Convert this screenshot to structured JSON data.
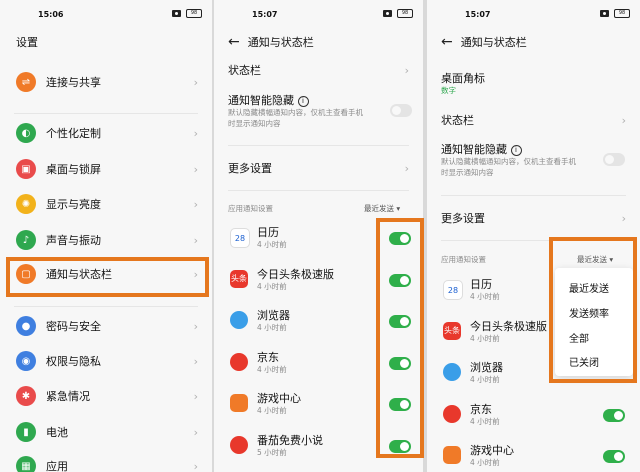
{
  "panel1": {
    "time": "15:06",
    "battery": "98",
    "title": "设置",
    "items": [
      {
        "label": "连接与共享",
        "icon": "share-icon",
        "color": "#f07a28"
      },
      {
        "label": "个性化定制",
        "icon": "palette-icon",
        "color": "#2fa84f"
      },
      {
        "label": "桌面与锁屏",
        "icon": "image-icon",
        "color": "#e94b4b"
      },
      {
        "label": "显示与亮度",
        "icon": "sun-icon",
        "color": "#f2b21b"
      },
      {
        "label": "声音与振动",
        "icon": "bell-icon",
        "color": "#2fa84f"
      },
      {
        "label": "通知与状态栏",
        "icon": "notification-icon",
        "color": "#f07a28"
      },
      {
        "label": "密码与安全",
        "icon": "lock-icon",
        "color": "#3f7fe0"
      },
      {
        "label": "权限与隐私",
        "icon": "eye-icon",
        "color": "#3f7fe0"
      },
      {
        "label": "紧急情况",
        "icon": "alert-icon",
        "color": "#e94b4b"
      },
      {
        "label": "电池",
        "icon": "battery-icon",
        "color": "#2fa84f"
      },
      {
        "label": "应用",
        "icon": "apps-icon",
        "color": "#2fa84f"
      }
    ]
  },
  "panel2": {
    "time": "15:07",
    "battery": "98",
    "title": "通知与状态栏",
    "status_bar": "状态栏",
    "smart_hide": "通知智能隐藏",
    "smart_hide_desc": "默认隐藏横幅通知内容，仅机主查看手机时显示通知内容",
    "more_settings": "更多设置",
    "app_notif_header": "应用通知设置",
    "sort_label": "最近发送",
    "apps": [
      {
        "name": "日历",
        "time": "4 小时前",
        "badge": "28",
        "color": "#ffffff"
      },
      {
        "name": "今日头条极速版",
        "time": "4 小时前",
        "badge": "头条",
        "color": "#e8382c"
      },
      {
        "name": "浏览器",
        "time": "4 小时前",
        "badge": "",
        "color": "#3a9ee8"
      },
      {
        "name": "京东",
        "time": "4 小时前",
        "badge": "",
        "color": "#e8382c"
      },
      {
        "name": "游戏中心",
        "time": "4 小时前",
        "badge": "",
        "color": "#f07a28"
      },
      {
        "name": "番茄免费小说",
        "time": "5 小时前",
        "badge": "",
        "color": "#e8382c"
      }
    ]
  },
  "panel3": {
    "time": "15:07",
    "battery": "98",
    "title": "通知与状态栏",
    "desktop_badge": "桌面角标",
    "desktop_badge_value": "数字",
    "status_bar": "状态栏",
    "smart_hide": "通知智能隐藏",
    "smart_hide_desc": "默认隐藏横幅通知内容，仅机主查看手机时显示通知内容",
    "more_settings": "更多设置",
    "app_notif_header": "应用通知设置",
    "sort_label": "最近发送",
    "dropdown": [
      "最近发送",
      "发送频率",
      "全部",
      "已关闭"
    ],
    "apps": [
      {
        "name": "日历",
        "time": "4 小时前",
        "badge": "28"
      },
      {
        "name": "今日头条极速版",
        "time": "4 小时前",
        "badge": "头条"
      },
      {
        "name": "浏览器",
        "time": "4 小时前",
        "badge": ""
      },
      {
        "name": "京东",
        "time": "4 小时前",
        "badge": ""
      },
      {
        "name": "游戏中心",
        "time": "4 小时前",
        "badge": ""
      }
    ]
  },
  "colors": {
    "accent_highlight": "#e5771e",
    "toggle_on": "#2faf4a",
    "header_green": "#2fa84f"
  }
}
